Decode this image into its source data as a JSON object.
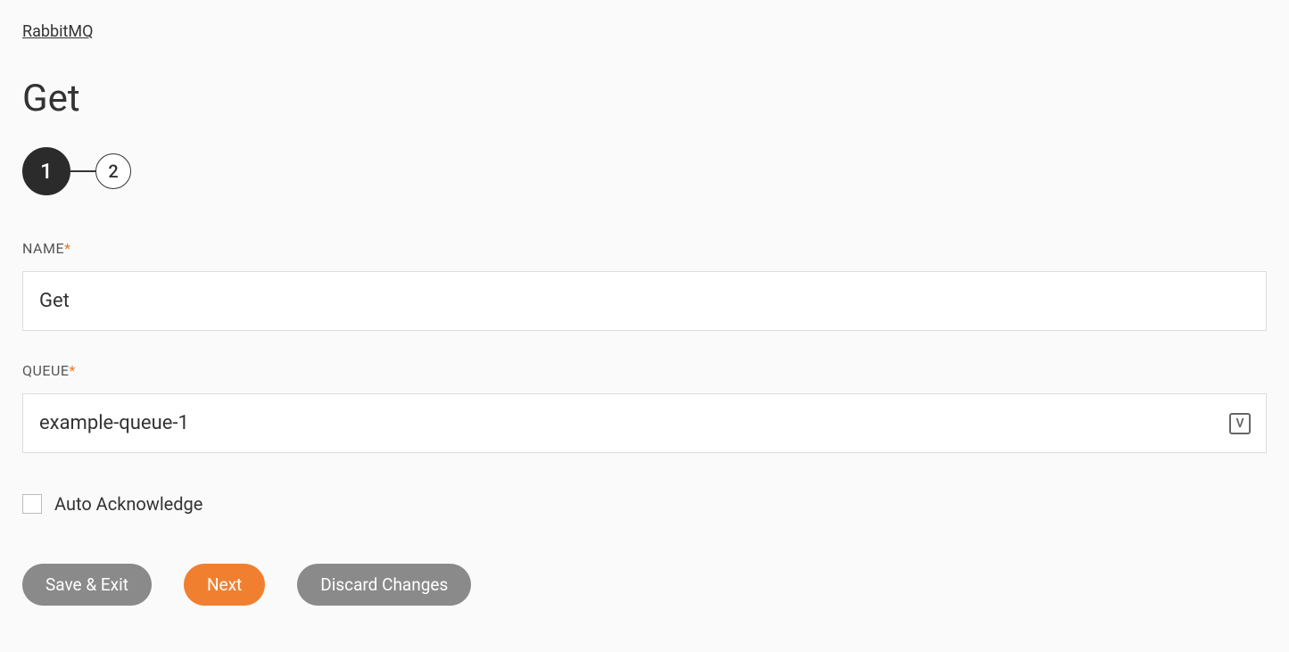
{
  "breadcrumb": {
    "label": "RabbitMQ"
  },
  "page": {
    "title": "Get"
  },
  "stepper": {
    "step1": "1",
    "step2": "2"
  },
  "form": {
    "name": {
      "label": "NAME",
      "value": "Get"
    },
    "queue": {
      "label": "QUEUE",
      "value": "example-queue-1"
    },
    "autoAck": {
      "label": "Auto Acknowledge",
      "checked": false
    }
  },
  "icons": {
    "variable": "V"
  },
  "buttons": {
    "saveExit": "Save & Exit",
    "next": "Next",
    "discard": "Discard Changes"
  }
}
